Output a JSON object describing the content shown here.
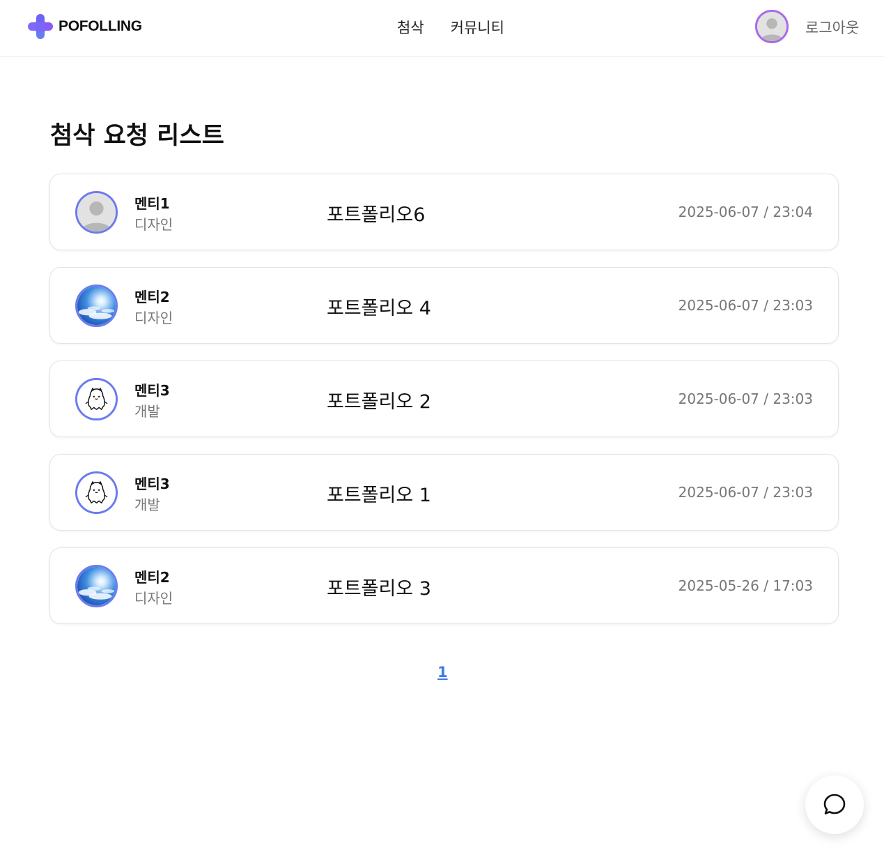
{
  "header": {
    "logo_text": "POFOLLING",
    "nav": [
      "첨삭",
      "커뮤니티"
    ],
    "logout_label": "로그아웃",
    "accent_color": "#a86ae8"
  },
  "main": {
    "title": "첨삭 요청 리스트",
    "items": [
      {
        "name": "멘티1",
        "field": "디자인",
        "title": "포트폴리오6",
        "date": "2025-06-07 / 23:04",
        "avatar": "default-user-icon"
      },
      {
        "name": "멘티2",
        "field": "디자인",
        "title": "포트폴리오 4",
        "date": "2025-06-07 / 23:03",
        "avatar": "sky-photo"
      },
      {
        "name": "멘티3",
        "field": "개발",
        "title": "포트폴리오 2",
        "date": "2025-06-07 / 23:03",
        "avatar": "ghost-character-icon"
      },
      {
        "name": "멘티3",
        "field": "개발",
        "title": "포트폴리오 1",
        "date": "2025-06-07 / 23:03",
        "avatar": "ghost-character-icon"
      },
      {
        "name": "멘티2",
        "field": "디자인",
        "title": "포트폴리오 3",
        "date": "2025-05-26 / 17:03",
        "avatar": "sky-photo"
      }
    ]
  },
  "pagination": {
    "current": "1"
  },
  "colors": {
    "avatar_border": "#6a7bf0",
    "link": "#3d7be6",
    "logo": "#7b5cf5"
  }
}
